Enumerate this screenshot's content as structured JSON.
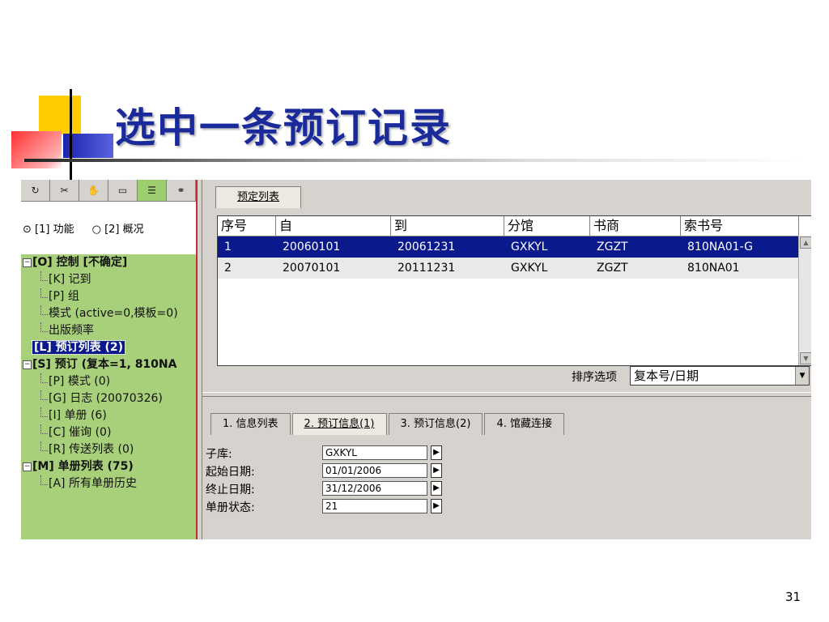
{
  "slide": {
    "title": "选中一条预订记录",
    "page_number": "31"
  },
  "left_panel": {
    "icon_tabs": [
      {
        "icon": "refresh-icon",
        "glyph": "↻",
        "active": false
      },
      {
        "icon": "tool-icon",
        "glyph": "✂",
        "active": false
      },
      {
        "icon": "hand-icon",
        "glyph": "✋",
        "active": false
      },
      {
        "icon": "folder-icon",
        "glyph": "▭",
        "active": false
      },
      {
        "icon": "list-icon",
        "glyph": "☰",
        "active": true
      },
      {
        "icon": "binoculars-icon",
        "glyph": "⚭",
        "active": false
      }
    ],
    "radio_function": "[1] 功能",
    "radio_overview": "[2] 概况",
    "tree": [
      {
        "label": "[O] 控制 [不确定]",
        "level": 0
      },
      {
        "label": "[K] 记到",
        "level": 1
      },
      {
        "label": "[P] 组",
        "level": 1
      },
      {
        "label": "模式 (active=0,模板=0)",
        "level": 1
      },
      {
        "label": "出版频率",
        "level": 1
      },
      {
        "label": "[L] 预订列表 (2)",
        "level": 0,
        "selected": true
      },
      {
        "label": "[S] 预订 (复本=1, 810NA",
        "level": 0
      },
      {
        "label": "[P] 模式 (0)",
        "level": 1
      },
      {
        "label": "[G] 日志 (20070326)",
        "level": 1
      },
      {
        "label": "[I] 单册 (6)",
        "level": 1
      },
      {
        "label": "[C] 催询 (0)",
        "level": 1
      },
      {
        "label": "[R] 传送列表 (0)",
        "level": 1
      },
      {
        "label": "[M] 单册列表 (75)",
        "level": 0
      },
      {
        "label": "[A] 所有单册历史",
        "level": 1
      }
    ]
  },
  "right_panel": {
    "top_tab": "预定列表",
    "grid": {
      "columns": [
        "序号",
        "自",
        "到",
        "分馆",
        "书商",
        "索书号"
      ],
      "rows": [
        [
          "1",
          "20060101",
          "20061231",
          "GXKYL",
          "ZGZT",
          "810NA01-G"
        ],
        [
          "2",
          "20070101",
          "20111231",
          "GXKYL",
          "ZGZT",
          "810NA01"
        ]
      ]
    },
    "sort_label": "排序选项",
    "sort_value": "复本号/日期",
    "bottom_tabs": [
      "1. 信息列表",
      "2. 预订信息(1)",
      "3. 预订信息(2)",
      "4. 馆藏连接"
    ],
    "form": [
      {
        "label": "子库:",
        "value": "GXKYL"
      },
      {
        "label": "起始日期:",
        "value": "01/01/2006"
      },
      {
        "label": "终止日期:",
        "value": "31/12/2006"
      },
      {
        "label": "单册状态:",
        "value": "21"
      }
    ]
  },
  "colors": {
    "title": "#1a2a9a",
    "tree_bg": "#a8d07a",
    "selection": "#0a1a8c"
  }
}
